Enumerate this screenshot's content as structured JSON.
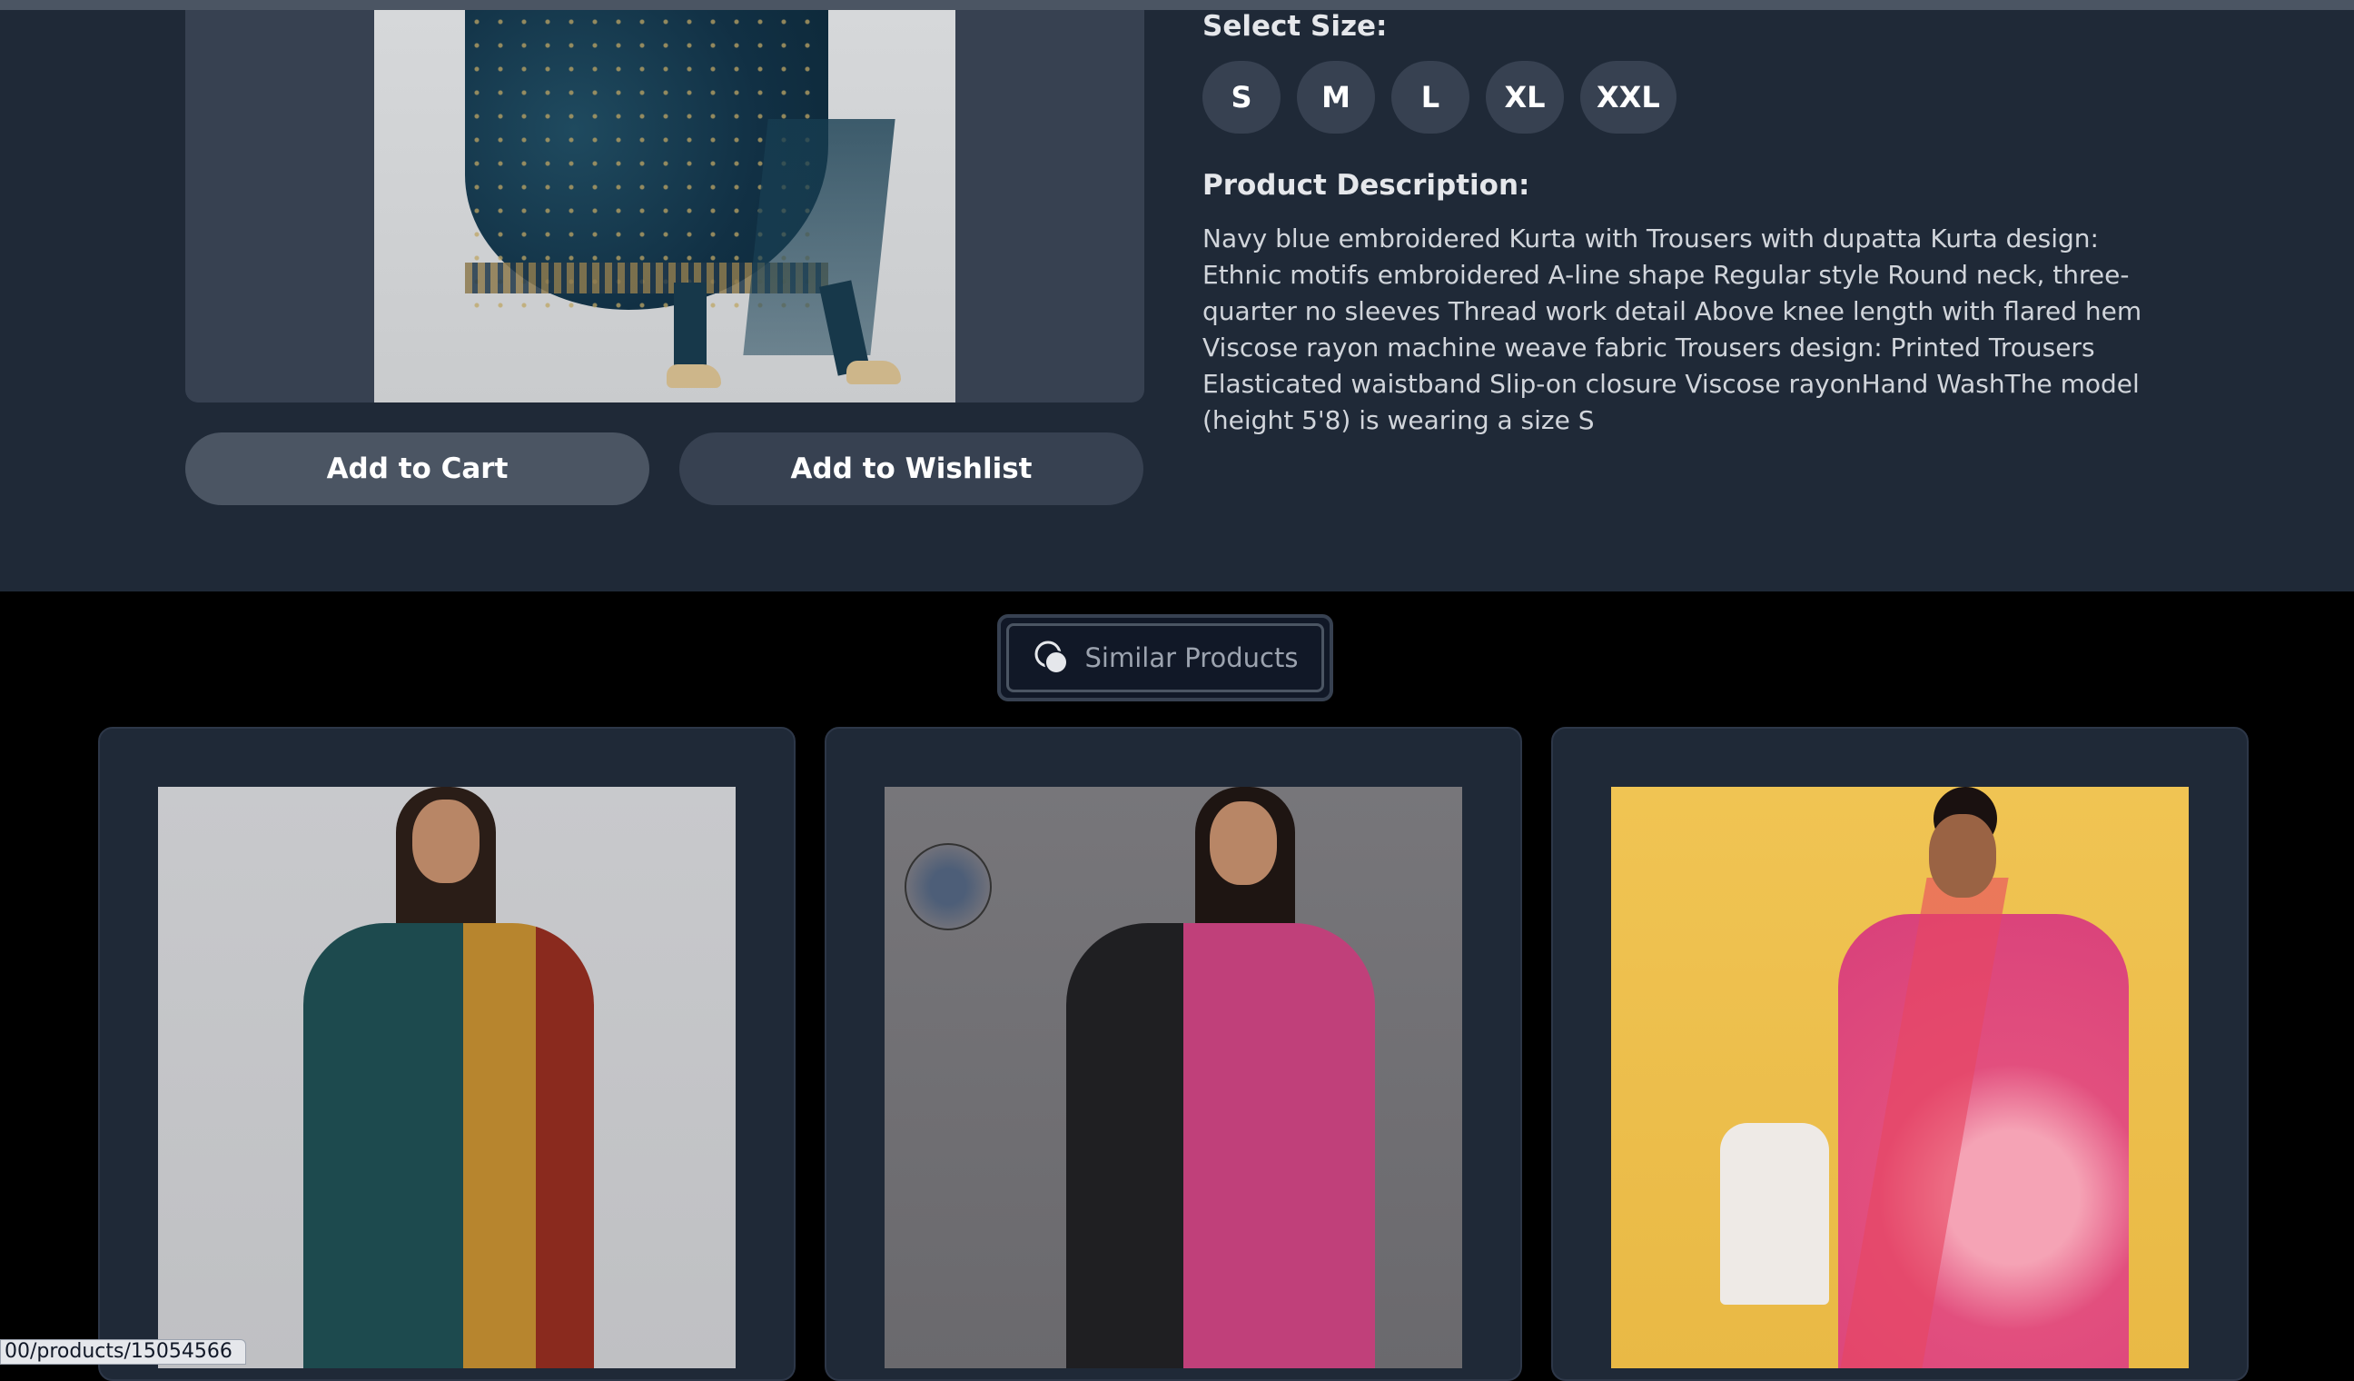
{
  "product": {
    "size_label": "Select Size:",
    "sizes": [
      "S",
      "M",
      "L",
      "XL",
      "XXL"
    ],
    "description_label": "Product Description:",
    "description": "Navy blue embroidered Kurta with Trousers with dupatta Kurta design: Ethnic motifs embroidered A-line shape Regular style Round neck, three-quarter no sleeves Thread work detail Above knee length with flared hem Viscose rayon machine weave fabric Trousers design: Printed Trousers Elasticated waistband Slip-on closure Viscose rayonHand WashThe model (height 5'8) is wearing a size S",
    "add_to_cart": "Add to Cart",
    "add_to_wishlist": "Add to Wishlist"
  },
  "similar": {
    "button_label": "Similar Products",
    "icon": "overlapping-circles-icon",
    "cards": [
      {
        "image": "green-kurta-model"
      },
      {
        "image": "pink-black-kurta-model",
        "badge_icon": "mask-icon"
      },
      {
        "image": "pink-floral-lehenga-model"
      }
    ]
  },
  "status_bar": {
    "url": "00/products/15054566"
  },
  "colors": {
    "page_bg": "#000000",
    "panel_bg": "#1f2937",
    "button_bg": "#4b5563",
    "size_chip_bg": "#374151"
  }
}
